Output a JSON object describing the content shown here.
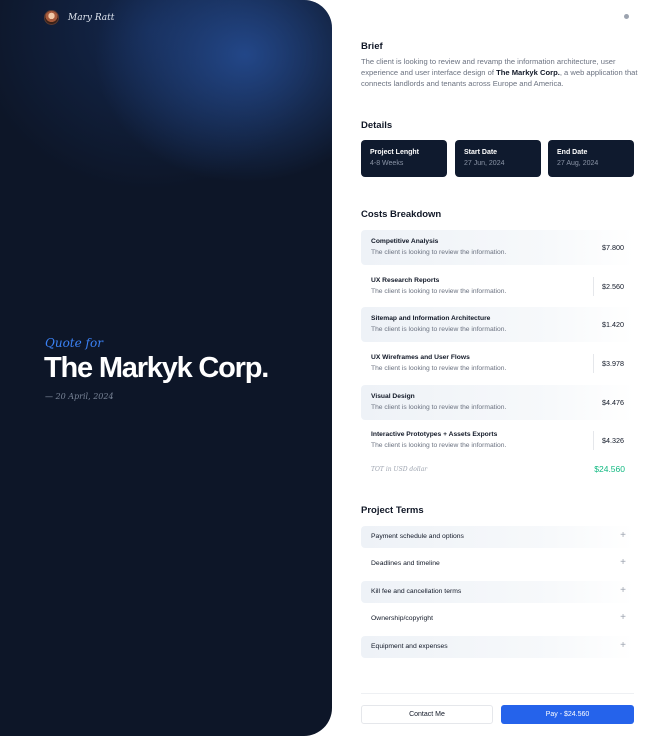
{
  "user": {
    "name": "Mary Ratt"
  },
  "hero": {
    "quote_for": "Quote for",
    "company": "The Markyk Corp.",
    "date": "— 20 April, 2024"
  },
  "brief": {
    "title": "Brief",
    "text_before": "The client is looking to review and revamp the information architecture, user experience and user interface design of ",
    "client_name": "The Markyk Corp.",
    "text_after": ", a web application that connects landlords and tenants across Europe and America."
  },
  "details": {
    "title": "Details",
    "cards": [
      {
        "label": "Project Lenght",
        "value": "4-8 Weeks"
      },
      {
        "label": "Start Date",
        "value": "27 Jun, 2024"
      },
      {
        "label": "End Date",
        "value": "27 Aug, 2024"
      }
    ]
  },
  "costs": {
    "title": "Costs Breakdown",
    "items": [
      {
        "name": "Competitive Analysis",
        "desc": "The client is looking to review the information.",
        "price": "$7.800"
      },
      {
        "name": "UX Research Reports",
        "desc": "The client is looking to review the information.",
        "price": "$2.560"
      },
      {
        "name": "Sitemap and Information Architecture",
        "desc": "The client is looking to review the information.",
        "price": "$1.420"
      },
      {
        "name": "UX Wireframes and User Flows",
        "desc": "The client is looking to review the information.",
        "price": "$3.978"
      },
      {
        "name": "Visual Design",
        "desc": "The client is looking to review the information.",
        "price": "$4.476"
      },
      {
        "name": "Interactive Prototypes + Assets Exports",
        "desc": "The client is looking to review the information.",
        "price": "$4.326"
      }
    ],
    "total_label": "TOT in USD dollar",
    "total_value": "$24.560"
  },
  "terms": {
    "title": "Project Terms",
    "items": [
      "Payment schedule and options",
      "Deadlines and timeline",
      "Kill fee and cancellation terms",
      "Ownership/copyright",
      "Equipment and expenses"
    ],
    "expand_icon": "plus-icon"
  },
  "actions": {
    "contact_label": "Contact Me",
    "pay_label": "Pay - $24.560"
  },
  "colors": {
    "hero_bg": "#0d1628",
    "accent": "#2563eb",
    "total": "#10b981"
  }
}
